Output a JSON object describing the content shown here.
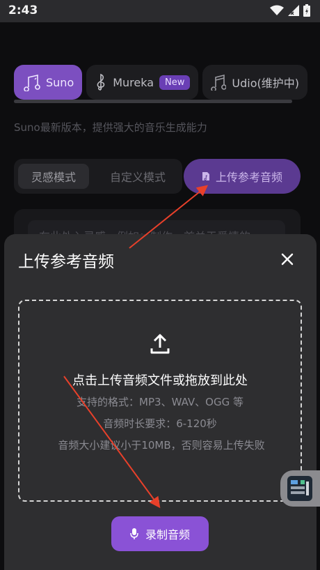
{
  "status_bar": {
    "time": "2:43"
  },
  "models": [
    {
      "label": "Suno",
      "icon": "music-note-icon",
      "active": true
    },
    {
      "label": "Mureka",
      "badge": "New",
      "icon": "treble-clef-icon"
    },
    {
      "label": "Udio(维护中)",
      "icon": "music-note-icon"
    }
  ],
  "description": "Suno最新版本，提供强大的音乐生成能力",
  "mode_tabs": {
    "inspiration": "灵感模式",
    "custom": "自定义模式"
  },
  "upload_reference_label": "上传参考音频",
  "prompt_input": {
    "placeholder": "在此处入灵感，例如：制作一首关于爱情的"
  },
  "sheet": {
    "title": "上传参考音频",
    "dropzone": {
      "main": "点击上传音频文件或拖放到此处",
      "formats": "支持的格式：MP3、WAV、OGG 等",
      "duration": "音频时长要求：6-120秒",
      "size_note": "音频大小建议小于10MB，否则容易上传失败"
    },
    "record_label": "录制音频"
  },
  "colors": {
    "accent": "#8a52d6",
    "annotation": "#e8402a",
    "sheet_bg": "#2e2e30"
  }
}
